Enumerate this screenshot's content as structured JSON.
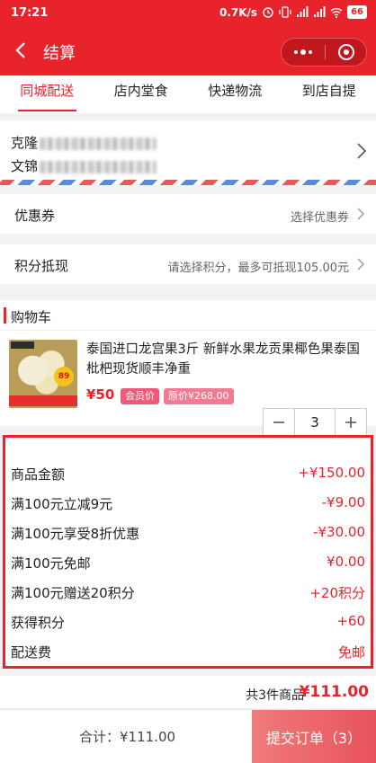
{
  "status_bar": {
    "time": "17:21",
    "speed": "0.7K/s",
    "battery": "66"
  },
  "nav": {
    "title": "结算"
  },
  "tabs": [
    {
      "label": "同城配送",
      "active": true
    },
    {
      "label": "店内堂食",
      "active": false
    },
    {
      "label": "快递物流",
      "active": false
    },
    {
      "label": "到店自提",
      "active": false
    }
  ],
  "address": {
    "line1_prefix": "克隆",
    "line2_prefix": "文锦"
  },
  "coupon": {
    "label": "优惠券",
    "value": "选择优惠券"
  },
  "points": {
    "label": "积分抵现",
    "value": "请选择积分，最多可抵现105.00元"
  },
  "cart": {
    "header": "购物车",
    "item": {
      "name": "泰国进口龙宫果3斤 新鲜水果龙贡果椰色果泰国枇杷现货顺丰净重",
      "price": "¥50",
      "member_tag": "会员价",
      "original_price": "原价¥268.00",
      "quantity": "3",
      "thumb_badge": "89"
    }
  },
  "summary": [
    {
      "label": "商品金额",
      "value": "+¥150.00"
    },
    {
      "label": "满100元立减9元",
      "value": "-¥9.00"
    },
    {
      "label": "满100元享受8折优惠",
      "value": "-¥30.00"
    },
    {
      "label": "满100元免邮",
      "value": "¥0.00"
    },
    {
      "label": "满100元赠送20积分",
      "value": "+20积分"
    },
    {
      "label": "获得积分",
      "value": "+60"
    },
    {
      "label": "配送费",
      "value": "免邮"
    }
  ],
  "total": {
    "count_text": "共3件商品",
    "amount": "¥111.00"
  },
  "footer": {
    "sum_text": "合计：¥111.00",
    "submit_label": "提交订单（3）"
  },
  "colors": {
    "primary": "#e8232b",
    "submit_bg": "#ec6068"
  }
}
